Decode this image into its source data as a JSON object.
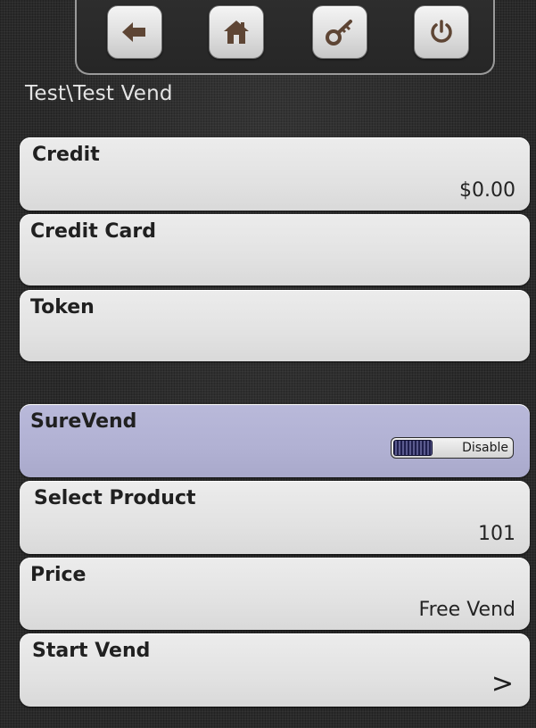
{
  "header": {
    "breadcrumb": "Test\\Test Vend",
    "nav_buttons": [
      {
        "name": "back",
        "icon": "arrow-left-icon"
      },
      {
        "name": "home",
        "icon": "home-icon"
      },
      {
        "name": "key",
        "icon": "key-icon"
      },
      {
        "name": "power",
        "icon": "power-icon"
      }
    ]
  },
  "items": {
    "credit": {
      "label": "Credit",
      "value": "$0.00"
    },
    "credit_card": {
      "label": "Credit Card",
      "value": ""
    },
    "token": {
      "label": "Token",
      "value": ""
    },
    "surevend": {
      "label": "SureVend",
      "toggle": "Disable"
    },
    "select_product": {
      "label": "Select Product",
      "value": "101"
    },
    "price": {
      "label": "Price",
      "value": "Free Vend"
    },
    "start_vend": {
      "label": "Start Vend",
      "chevron": ">"
    }
  },
  "colors": {
    "background": "#2a2a2a",
    "panel": "#e4e4e4",
    "highlight_panel": "#b3b3d5",
    "toggle_knob": "#262657",
    "breadcrumb_text": "#e4e4e4",
    "icon_brown": "#5e4534"
  }
}
